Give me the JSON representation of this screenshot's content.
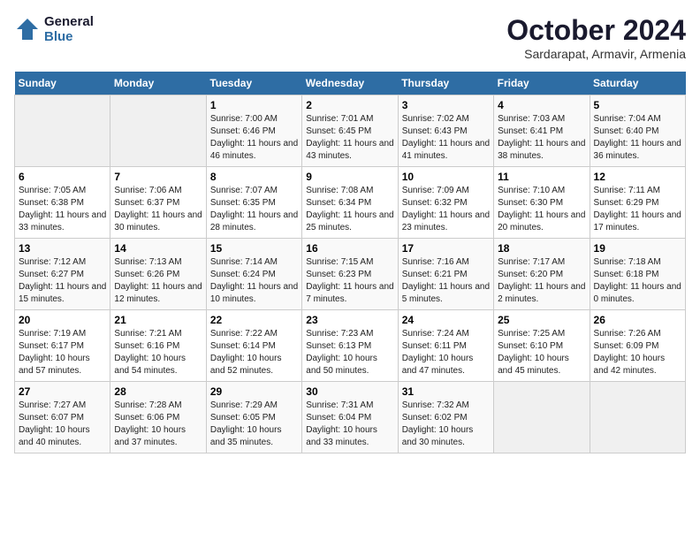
{
  "logo": {
    "line1": "General",
    "line2": "Blue"
  },
  "title": "October 2024",
  "location": "Sardarapat, Armavir, Armenia",
  "weekdays": [
    "Sunday",
    "Monday",
    "Tuesday",
    "Wednesday",
    "Thursday",
    "Friday",
    "Saturday"
  ],
  "weeks": [
    [
      {
        "day": "",
        "info": ""
      },
      {
        "day": "",
        "info": ""
      },
      {
        "day": "1",
        "info": "Sunrise: 7:00 AM\nSunset: 6:46 PM\nDaylight: 11 hours and 46 minutes."
      },
      {
        "day": "2",
        "info": "Sunrise: 7:01 AM\nSunset: 6:45 PM\nDaylight: 11 hours and 43 minutes."
      },
      {
        "day": "3",
        "info": "Sunrise: 7:02 AM\nSunset: 6:43 PM\nDaylight: 11 hours and 41 minutes."
      },
      {
        "day": "4",
        "info": "Sunrise: 7:03 AM\nSunset: 6:41 PM\nDaylight: 11 hours and 38 minutes."
      },
      {
        "day": "5",
        "info": "Sunrise: 7:04 AM\nSunset: 6:40 PM\nDaylight: 11 hours and 36 minutes."
      }
    ],
    [
      {
        "day": "6",
        "info": "Sunrise: 7:05 AM\nSunset: 6:38 PM\nDaylight: 11 hours and 33 minutes."
      },
      {
        "day": "7",
        "info": "Sunrise: 7:06 AM\nSunset: 6:37 PM\nDaylight: 11 hours and 30 minutes."
      },
      {
        "day": "8",
        "info": "Sunrise: 7:07 AM\nSunset: 6:35 PM\nDaylight: 11 hours and 28 minutes."
      },
      {
        "day": "9",
        "info": "Sunrise: 7:08 AM\nSunset: 6:34 PM\nDaylight: 11 hours and 25 minutes."
      },
      {
        "day": "10",
        "info": "Sunrise: 7:09 AM\nSunset: 6:32 PM\nDaylight: 11 hours and 23 minutes."
      },
      {
        "day": "11",
        "info": "Sunrise: 7:10 AM\nSunset: 6:30 PM\nDaylight: 11 hours and 20 minutes."
      },
      {
        "day": "12",
        "info": "Sunrise: 7:11 AM\nSunset: 6:29 PM\nDaylight: 11 hours and 17 minutes."
      }
    ],
    [
      {
        "day": "13",
        "info": "Sunrise: 7:12 AM\nSunset: 6:27 PM\nDaylight: 11 hours and 15 minutes."
      },
      {
        "day": "14",
        "info": "Sunrise: 7:13 AM\nSunset: 6:26 PM\nDaylight: 11 hours and 12 minutes."
      },
      {
        "day": "15",
        "info": "Sunrise: 7:14 AM\nSunset: 6:24 PM\nDaylight: 11 hours and 10 minutes."
      },
      {
        "day": "16",
        "info": "Sunrise: 7:15 AM\nSunset: 6:23 PM\nDaylight: 11 hours and 7 minutes."
      },
      {
        "day": "17",
        "info": "Sunrise: 7:16 AM\nSunset: 6:21 PM\nDaylight: 11 hours and 5 minutes."
      },
      {
        "day": "18",
        "info": "Sunrise: 7:17 AM\nSunset: 6:20 PM\nDaylight: 11 hours and 2 minutes."
      },
      {
        "day": "19",
        "info": "Sunrise: 7:18 AM\nSunset: 6:18 PM\nDaylight: 11 hours and 0 minutes."
      }
    ],
    [
      {
        "day": "20",
        "info": "Sunrise: 7:19 AM\nSunset: 6:17 PM\nDaylight: 10 hours and 57 minutes."
      },
      {
        "day": "21",
        "info": "Sunrise: 7:21 AM\nSunset: 6:16 PM\nDaylight: 10 hours and 54 minutes."
      },
      {
        "day": "22",
        "info": "Sunrise: 7:22 AM\nSunset: 6:14 PM\nDaylight: 10 hours and 52 minutes."
      },
      {
        "day": "23",
        "info": "Sunrise: 7:23 AM\nSunset: 6:13 PM\nDaylight: 10 hours and 50 minutes."
      },
      {
        "day": "24",
        "info": "Sunrise: 7:24 AM\nSunset: 6:11 PM\nDaylight: 10 hours and 47 minutes."
      },
      {
        "day": "25",
        "info": "Sunrise: 7:25 AM\nSunset: 6:10 PM\nDaylight: 10 hours and 45 minutes."
      },
      {
        "day": "26",
        "info": "Sunrise: 7:26 AM\nSunset: 6:09 PM\nDaylight: 10 hours and 42 minutes."
      }
    ],
    [
      {
        "day": "27",
        "info": "Sunrise: 7:27 AM\nSunset: 6:07 PM\nDaylight: 10 hours and 40 minutes."
      },
      {
        "day": "28",
        "info": "Sunrise: 7:28 AM\nSunset: 6:06 PM\nDaylight: 10 hours and 37 minutes."
      },
      {
        "day": "29",
        "info": "Sunrise: 7:29 AM\nSunset: 6:05 PM\nDaylight: 10 hours and 35 minutes."
      },
      {
        "day": "30",
        "info": "Sunrise: 7:31 AM\nSunset: 6:04 PM\nDaylight: 10 hours and 33 minutes."
      },
      {
        "day": "31",
        "info": "Sunrise: 7:32 AM\nSunset: 6:02 PM\nDaylight: 10 hours and 30 minutes."
      },
      {
        "day": "",
        "info": ""
      },
      {
        "day": "",
        "info": ""
      }
    ]
  ]
}
